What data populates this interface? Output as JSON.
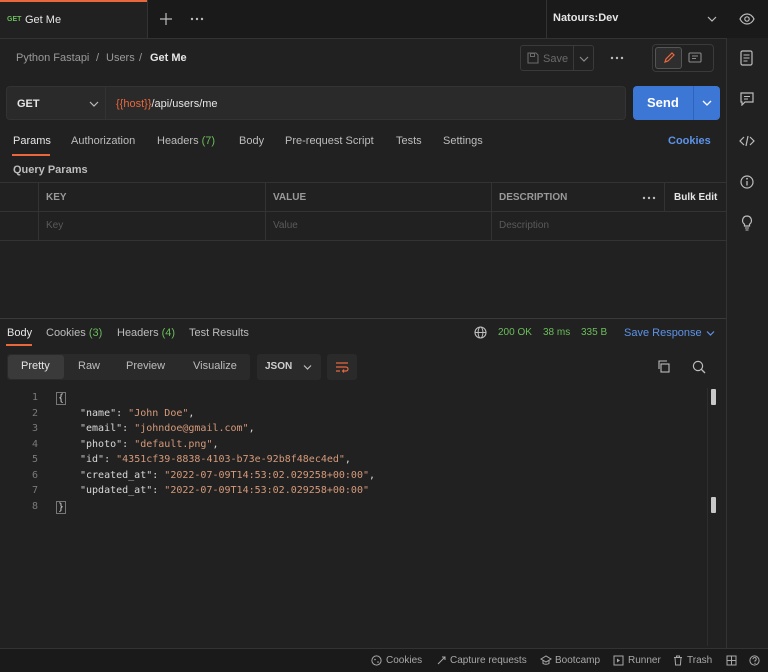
{
  "tab": {
    "method": "GET",
    "title": "Get Me"
  },
  "environment": {
    "name": "Natours:Dev"
  },
  "breadcrumb": [
    "Python Fastapi",
    "Users",
    "Get Me"
  ],
  "toolbar": {
    "save_label": "Save"
  },
  "request": {
    "method": "GET",
    "url_var": "{{host}}",
    "url_path": "/api/users/me",
    "send_label": "Send",
    "tabs": [
      "Params",
      "Authorization",
      "Headers",
      "Body",
      "Pre-request Script",
      "Tests",
      "Settings"
    ],
    "headers_count": "(7)",
    "cookies_label": "Cookies",
    "query_params_title": "Query Params",
    "table": {
      "headers": [
        "KEY",
        "VALUE",
        "DESCRIPTION"
      ],
      "bulk_edit": "Bulk Edit",
      "placeholders": [
        "Key",
        "Value",
        "Description"
      ]
    }
  },
  "response": {
    "tabs": [
      "Body",
      "Cookies",
      "Headers",
      "Test Results"
    ],
    "cookies_count": "(3)",
    "headers_count": "(4)",
    "status": "200 OK",
    "time": "38 ms",
    "size": "335 B",
    "save_response": "Save Response",
    "view_modes": [
      "Pretty",
      "Raw",
      "Preview",
      "Visualize"
    ],
    "format": "JSON",
    "body": {
      "open": "{",
      "close": "}",
      "fields": [
        {
          "key": "\"name\"",
          "value": "\"John Doe\"",
          "comma": ","
        },
        {
          "key": "\"email\"",
          "value": "\"johndoe@gmail.com\"",
          "comma": ","
        },
        {
          "key": "\"photo\"",
          "value": "\"default.png\"",
          "comma": ","
        },
        {
          "key": "\"id\"",
          "value": "\"4351cf39-8838-4103-b73e-92b8f48ec4ed\"",
          "comma": ","
        },
        {
          "key": "\"created_at\"",
          "value": "\"2022-07-09T14:53:02.029258+00:00\"",
          "comma": ","
        },
        {
          "key": "\"updated_at\"",
          "value": "\"2022-07-09T14:53:02.029258+00:00\"",
          "comma": ""
        }
      ],
      "line_numbers": [
        "1",
        "2",
        "3",
        "4",
        "5",
        "6",
        "7",
        "8"
      ]
    }
  },
  "statusbar": [
    "Cookies",
    "Capture requests",
    "Bootcamp",
    "Runner",
    "Trash"
  ],
  "colors": {
    "accent": "#e8673d",
    "send": "#3d77d6",
    "link": "#5d93e8",
    "ok": "#6bbd5b",
    "string": "#d69a7a"
  }
}
